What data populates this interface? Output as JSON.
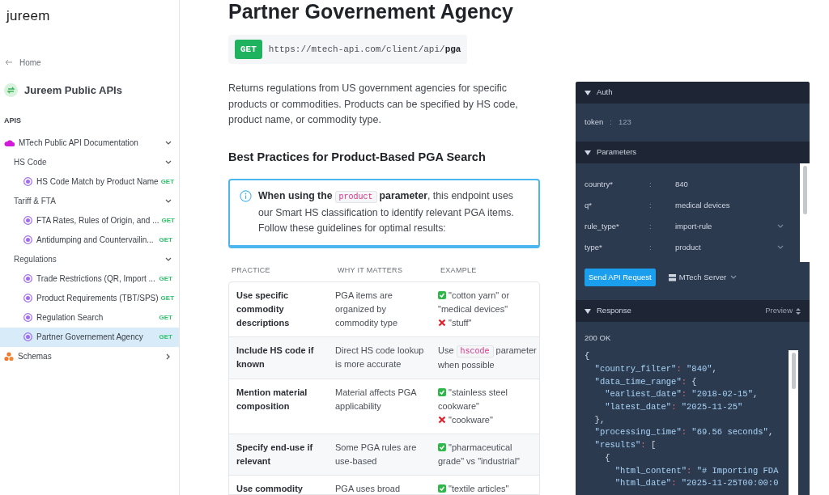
{
  "brand": "jureem",
  "home_link": "Home",
  "project": {
    "title": "Jureem Public APIs"
  },
  "sidebar": {
    "section_label": "APIS",
    "items": [
      {
        "kind": "folder",
        "label": "MTech Public API Documentation",
        "expanded": true,
        "children": [
          {
            "kind": "group",
            "label": "HS Code",
            "expanded": true,
            "children": [
              {
                "kind": "endpoint",
                "label": "HS Code Match by Product Name",
                "method": "GET",
                "selected": false
              }
            ]
          },
          {
            "kind": "group",
            "label": "Tariff & FTA",
            "expanded": true,
            "children": [
              {
                "kind": "endpoint",
                "label": "FTA Rates, Rules of Origin, and ...",
                "method": "GET",
                "selected": false
              },
              {
                "kind": "endpoint",
                "label": "Antidumping and Countervailin...",
                "method": "GET",
                "selected": false
              }
            ]
          },
          {
            "kind": "group",
            "label": "Regulations",
            "expanded": true,
            "children": [
              {
                "kind": "endpoint",
                "label": "Trade Restrictions (QR, Import ...",
                "method": "GET",
                "selected": false
              },
              {
                "kind": "endpoint",
                "label": "Product Requirements (TBT/SPS)",
                "method": "GET",
                "selected": false
              },
              {
                "kind": "endpoint",
                "label": "Regulation Search",
                "method": "GET",
                "selected": false
              },
              {
                "kind": "endpoint",
                "label": "Partner Governement Agency",
                "method": "GET",
                "selected": true
              }
            ]
          }
        ]
      },
      {
        "kind": "schemas",
        "label": "Schemas",
        "expanded": false
      }
    ]
  },
  "page": {
    "title": "Partner Governement Agency",
    "method": "GET",
    "url_base": "https://mtech-api.com/client/api/",
    "url_path": "pga",
    "description": "Returns regulations from US government agencies for specific products or commodities. Products can be specified by HS code, product name, or commodity type.",
    "section_title": "Best Practices for Product-Based PGA Search",
    "callout": [
      {
        "kind": "bold",
        "text": "When using the"
      },
      {
        "kind": "code",
        "text": "product"
      },
      {
        "kind": "bold",
        "text": "parameter"
      },
      {
        "kind": "plain",
        "text": ", this endpoint uses our Smart HS classification to identify relevant PGA items. Follow these guidelines for optimal results:"
      }
    ],
    "table": {
      "columns": [
        "PRACTICE",
        "WHY IT MATTERS",
        "EXAMPLE"
      ],
      "rows": [
        {
          "practice": "Use specific commodity descriptions",
          "why": "PGA items are organized by commodity type",
          "example": [
            {
              "kind": "good",
              "parts": [
                {
                  "kind": "plain",
                  "text": "\"cotton yarn\" or \"medical devices\""
                }
              ]
            },
            {
              "kind": "bad",
              "parts": [
                {
                  "kind": "plain",
                  "text": "\"stuff\""
                }
              ]
            }
          ]
        },
        {
          "practice": "Include HS code if known",
          "why": "Direct HS code lookup is more accurate",
          "example": [
            {
              "kind": "plain",
              "parts": [
                {
                  "kind": "plain",
                  "text": "Use"
                },
                {
                  "kind": "code",
                  "text": "hscode"
                },
                {
                  "kind": "plain",
                  "text": "parameter when possible"
                }
              ]
            }
          ]
        },
        {
          "practice": "Mention material composition",
          "why": "Material affects PGA applicability",
          "example": [
            {
              "kind": "good",
              "parts": [
                {
                  "kind": "plain",
                  "text": "\"stainless steel cookware\""
                }
              ]
            },
            {
              "kind": "bad",
              "parts": [
                {
                  "kind": "plain",
                  "text": "\"cookware\""
                }
              ]
            }
          ]
        },
        {
          "practice": "Specify end-use if relevant",
          "why": "Some PGA rules are use-based",
          "example": [
            {
              "kind": "good",
              "parts": [
                {
                  "kind": "plain",
                  "text": "\"pharmaceutical grade\" vs \"industrial\""
                }
              ]
            }
          ]
        },
        {
          "practice": "Use commodity",
          "why": "PGA uses broad",
          "example": [
            {
              "kind": "good",
              "parts": [
                {
                  "kind": "plain",
                  "text": "\"textile articles\""
                }
              ]
            }
          ]
        }
      ]
    }
  },
  "panel": {
    "auth": {
      "title": "Auth",
      "expanded": true,
      "label": "token",
      "separator": ":",
      "value": "123"
    },
    "parameters": {
      "title": "Parameters",
      "expanded": true,
      "rows": [
        {
          "kind": "text",
          "label": "country*",
          "separator": ":",
          "value": "840"
        },
        {
          "kind": "text",
          "label": "q*",
          "separator": ":",
          "value": "medical devices"
        },
        {
          "kind": "select",
          "label": "rule_type*",
          "separator": ":",
          "value": "import-rule"
        },
        {
          "kind": "select",
          "label": "type*",
          "separator": ":",
          "value": "product"
        }
      ]
    },
    "send_button": "Send API Request",
    "server": "MTech Server",
    "response": {
      "title": "Response",
      "expanded": true,
      "view": "Preview",
      "status": "200 OK",
      "code_lines": [
        "{",
        "  \"country_filter\": \"840\",",
        "  \"data_time_range\": {",
        "    \"earliest_date\": \"2018-02-15\",",
        "    \"latest_date\": \"2025-11-25\"",
        "  },",
        "  \"processing_time\": \"69.56 seconds\",",
        "  \"results\": [",
        "    {",
        "      \"html_content\": \"# Importing FDA",
        "      \"html_date\": \"2025-11-25T00:00:0"
      ]
    }
  }
}
